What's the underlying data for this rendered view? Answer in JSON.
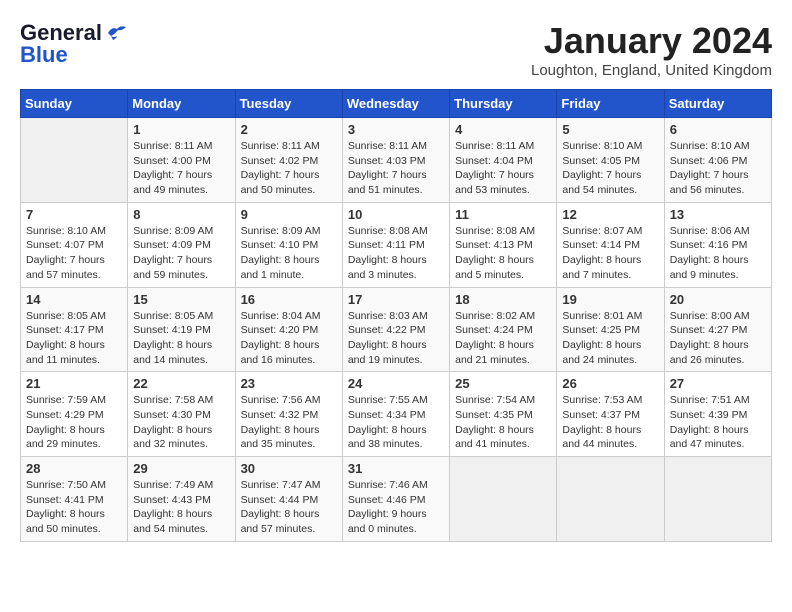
{
  "header": {
    "logo_line1": "General",
    "logo_line2": "Blue",
    "month": "January 2024",
    "location": "Loughton, England, United Kingdom"
  },
  "days_of_week": [
    "Sunday",
    "Monday",
    "Tuesday",
    "Wednesday",
    "Thursday",
    "Friday",
    "Saturday"
  ],
  "weeks": [
    [
      {
        "day": "",
        "content": ""
      },
      {
        "day": "1",
        "content": "Sunrise: 8:11 AM\nSunset: 4:00 PM\nDaylight: 7 hours\nand 49 minutes."
      },
      {
        "day": "2",
        "content": "Sunrise: 8:11 AM\nSunset: 4:02 PM\nDaylight: 7 hours\nand 50 minutes."
      },
      {
        "day": "3",
        "content": "Sunrise: 8:11 AM\nSunset: 4:03 PM\nDaylight: 7 hours\nand 51 minutes."
      },
      {
        "day": "4",
        "content": "Sunrise: 8:11 AM\nSunset: 4:04 PM\nDaylight: 7 hours\nand 53 minutes."
      },
      {
        "day": "5",
        "content": "Sunrise: 8:10 AM\nSunset: 4:05 PM\nDaylight: 7 hours\nand 54 minutes."
      },
      {
        "day": "6",
        "content": "Sunrise: 8:10 AM\nSunset: 4:06 PM\nDaylight: 7 hours\nand 56 minutes."
      }
    ],
    [
      {
        "day": "7",
        "content": "Sunrise: 8:10 AM\nSunset: 4:07 PM\nDaylight: 7 hours\nand 57 minutes."
      },
      {
        "day": "8",
        "content": "Sunrise: 8:09 AM\nSunset: 4:09 PM\nDaylight: 7 hours\nand 59 minutes."
      },
      {
        "day": "9",
        "content": "Sunrise: 8:09 AM\nSunset: 4:10 PM\nDaylight: 8 hours\nand 1 minute."
      },
      {
        "day": "10",
        "content": "Sunrise: 8:08 AM\nSunset: 4:11 PM\nDaylight: 8 hours\nand 3 minutes."
      },
      {
        "day": "11",
        "content": "Sunrise: 8:08 AM\nSunset: 4:13 PM\nDaylight: 8 hours\nand 5 minutes."
      },
      {
        "day": "12",
        "content": "Sunrise: 8:07 AM\nSunset: 4:14 PM\nDaylight: 8 hours\nand 7 minutes."
      },
      {
        "day": "13",
        "content": "Sunrise: 8:06 AM\nSunset: 4:16 PM\nDaylight: 8 hours\nand 9 minutes."
      }
    ],
    [
      {
        "day": "14",
        "content": "Sunrise: 8:05 AM\nSunset: 4:17 PM\nDaylight: 8 hours\nand 11 minutes."
      },
      {
        "day": "15",
        "content": "Sunrise: 8:05 AM\nSunset: 4:19 PM\nDaylight: 8 hours\nand 14 minutes."
      },
      {
        "day": "16",
        "content": "Sunrise: 8:04 AM\nSunset: 4:20 PM\nDaylight: 8 hours\nand 16 minutes."
      },
      {
        "day": "17",
        "content": "Sunrise: 8:03 AM\nSunset: 4:22 PM\nDaylight: 8 hours\nand 19 minutes."
      },
      {
        "day": "18",
        "content": "Sunrise: 8:02 AM\nSunset: 4:24 PM\nDaylight: 8 hours\nand 21 minutes."
      },
      {
        "day": "19",
        "content": "Sunrise: 8:01 AM\nSunset: 4:25 PM\nDaylight: 8 hours\nand 24 minutes."
      },
      {
        "day": "20",
        "content": "Sunrise: 8:00 AM\nSunset: 4:27 PM\nDaylight: 8 hours\nand 26 minutes."
      }
    ],
    [
      {
        "day": "21",
        "content": "Sunrise: 7:59 AM\nSunset: 4:29 PM\nDaylight: 8 hours\nand 29 minutes."
      },
      {
        "day": "22",
        "content": "Sunrise: 7:58 AM\nSunset: 4:30 PM\nDaylight: 8 hours\nand 32 minutes."
      },
      {
        "day": "23",
        "content": "Sunrise: 7:56 AM\nSunset: 4:32 PM\nDaylight: 8 hours\nand 35 minutes."
      },
      {
        "day": "24",
        "content": "Sunrise: 7:55 AM\nSunset: 4:34 PM\nDaylight: 8 hours\nand 38 minutes."
      },
      {
        "day": "25",
        "content": "Sunrise: 7:54 AM\nSunset: 4:35 PM\nDaylight: 8 hours\nand 41 minutes."
      },
      {
        "day": "26",
        "content": "Sunrise: 7:53 AM\nSunset: 4:37 PM\nDaylight: 8 hours\nand 44 minutes."
      },
      {
        "day": "27",
        "content": "Sunrise: 7:51 AM\nSunset: 4:39 PM\nDaylight: 8 hours\nand 47 minutes."
      }
    ],
    [
      {
        "day": "28",
        "content": "Sunrise: 7:50 AM\nSunset: 4:41 PM\nDaylight: 8 hours\nand 50 minutes."
      },
      {
        "day": "29",
        "content": "Sunrise: 7:49 AM\nSunset: 4:43 PM\nDaylight: 8 hours\nand 54 minutes."
      },
      {
        "day": "30",
        "content": "Sunrise: 7:47 AM\nSunset: 4:44 PM\nDaylight: 8 hours\nand 57 minutes."
      },
      {
        "day": "31",
        "content": "Sunrise: 7:46 AM\nSunset: 4:46 PM\nDaylight: 9 hours\nand 0 minutes."
      },
      {
        "day": "",
        "content": ""
      },
      {
        "day": "",
        "content": ""
      },
      {
        "day": "",
        "content": ""
      }
    ]
  ]
}
